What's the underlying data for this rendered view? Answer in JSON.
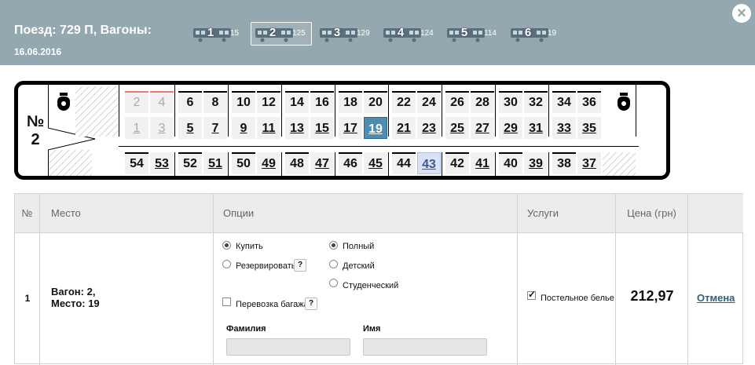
{
  "header": {
    "title": "Поезд: 729 П, Вагоны:",
    "date": "16.06.2016",
    "wagons": [
      {
        "num": "1",
        "free": "15"
      },
      {
        "num": "2",
        "free": "125",
        "selected": true
      },
      {
        "num": "3",
        "free": "129"
      },
      {
        "num": "4",
        "free": "124"
      },
      {
        "num": "5",
        "free": "114"
      },
      {
        "num": "6",
        "free": "19"
      }
    ],
    "close_icon": "close-icon"
  },
  "carriage": {
    "label_no": "№",
    "label_num": "2",
    "upper_row": [
      "2",
      "4",
      "6",
      "8",
      "10",
      "12",
      "14",
      "16",
      "18",
      "20",
      "22",
      "24",
      "26",
      "28",
      "30",
      "32",
      "34",
      "36"
    ],
    "lower_row": [
      "1",
      "3",
      "5",
      "7",
      "9",
      "11",
      "13",
      "15",
      "17",
      "19",
      "21",
      "23",
      "25",
      "27",
      "29",
      "31",
      "33",
      "35"
    ],
    "side_upper": [
      "54",
      "52",
      "50",
      "48",
      "46",
      "44",
      "42",
      "40",
      "38"
    ],
    "side_lower": [
      "53",
      "51",
      "49",
      "47",
      "45",
      "43",
      "41",
      "39",
      "37"
    ],
    "taken": [
      "1",
      "2",
      "3",
      "4"
    ],
    "selected_seat": "19",
    "hovered_seat": "43",
    "icons": [
      "toilet-icon",
      "toilet-icon"
    ]
  },
  "table": {
    "headers": {
      "num": "№",
      "place": "Место",
      "options": "Опции",
      "services": "Услуги",
      "price": "Цена (грн)"
    },
    "row": {
      "num": "1",
      "place_line1": "Вагон: 2,",
      "place_line2": "Место: 19",
      "buy": "Купить",
      "reserve": "Резервировать",
      "full": "Полный",
      "child": "Детский",
      "student": "Студенческий",
      "baggage": "Перевозка багажа",
      "help": "?",
      "surname_label": "Фамилия",
      "name_label": "Имя",
      "surname_value": "",
      "name_value": "",
      "bedding": "Постельное белье",
      "price": "212,97",
      "cancel": "Отмена"
    }
  }
}
